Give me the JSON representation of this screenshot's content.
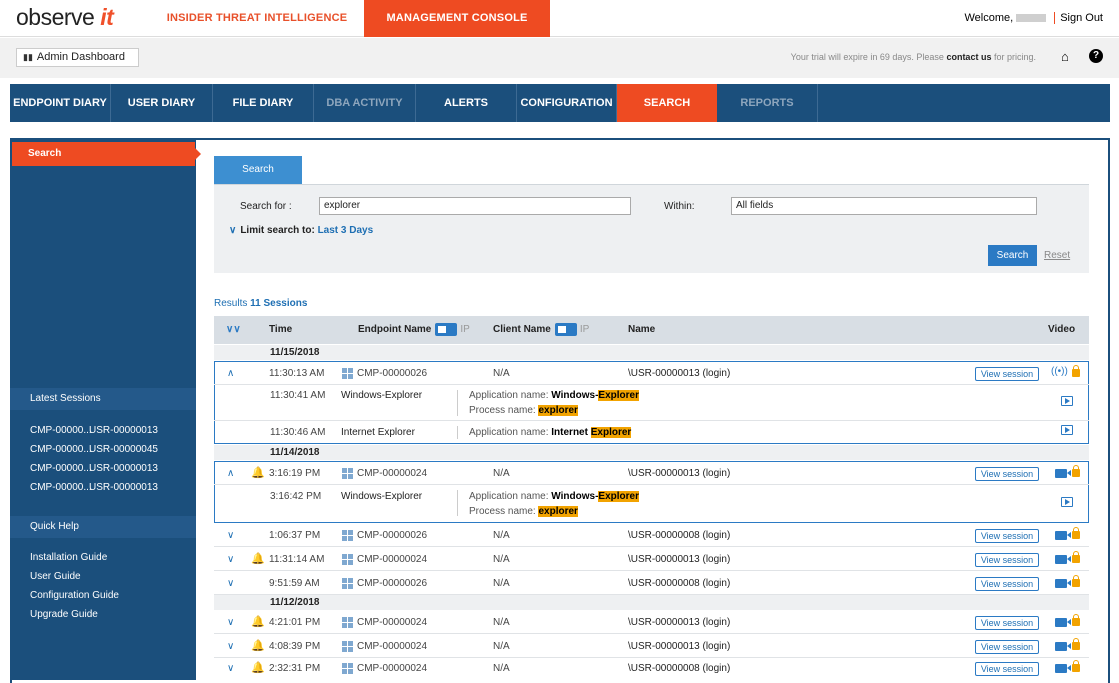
{
  "topbar": {
    "logo_text": "observe",
    "logo_accent": "it",
    "tab_insider": "INSIDER THREAT INTELLIGENCE",
    "tab_console": "MANAGEMENT CONSOLE",
    "welcome": "Welcome,",
    "sign_out": "Sign Out"
  },
  "subbar": {
    "admin_dashboard": "Admin Dashboard",
    "trial_text": "Your trial will expire in 69 days. Please",
    "contact": "contact us",
    "trial_suffix": "for pricing."
  },
  "nav": [
    "ENDPOINT DIARY",
    "USER DIARY",
    "FILE DIARY",
    "DBA ACTIVITY",
    "ALERTS",
    "CONFIGURATION",
    "SEARCH",
    "REPORTS"
  ],
  "sidebar": {
    "active": "Search",
    "latest_sessions_title": "Latest Sessions",
    "latest_sessions": [
      {
        "endpoint": "CMP-00000...",
        "user": "USR-00000013"
      },
      {
        "endpoint": "CMP-00000...",
        "user": "USR-00000045"
      },
      {
        "endpoint": "CMP-00000...",
        "user": "USR-00000013"
      },
      {
        "endpoint": "CMP-00000...",
        "user": "USR-00000013"
      }
    ],
    "quick_help_title": "Quick Help",
    "quick_help": [
      "Installation Guide",
      "User Guide",
      "Configuration Guide",
      "Upgrade Guide"
    ]
  },
  "search": {
    "tab": "Search",
    "search_for_label": "Search for :",
    "search_for_value": "explorer",
    "within_label": "Within:",
    "within_value": "All fields",
    "limit_label": "Limit search to:",
    "limit_value": "Last 3 Days",
    "search_button": "Search",
    "reset_button": "Reset"
  },
  "results": {
    "label": "Results",
    "count": "11 Sessions"
  },
  "table_headers": {
    "time": "Time",
    "endpoint": "Endpoint",
    "endpoint_name": "Name",
    "ip": "IP",
    "client": "Client",
    "client_name": "Name",
    "ip2": "IP",
    "name": "Name",
    "video": "Video"
  },
  "dates": [
    "11/15/2018",
    "11/14/2018",
    "11/12/2018"
  ],
  "view_session": "View session",
  "rows": [
    {
      "time": "11:30:13 AM",
      "endpoint": "CMP-00000026",
      "client": "N/A",
      "name": "\\USR-00000013 (login)"
    },
    {
      "time": "3:16:19 PM",
      "endpoint": "CMP-00000024",
      "client": "N/A",
      "name": "\\USR-00000013 (login)"
    },
    {
      "time": "1:06:37 PM",
      "endpoint": "CMP-00000026",
      "client": "N/A",
      "name": "\\USR-00000008 (login)"
    },
    {
      "time": "11:31:14 AM",
      "endpoint": "CMP-00000024",
      "client": "N/A",
      "name": "\\USR-00000013 (login)"
    },
    {
      "time": "9:51:59 AM",
      "endpoint": "CMP-00000026",
      "client": "N/A",
      "name": "\\USR-00000008 (login)"
    },
    {
      "time": "4:21:01 PM",
      "endpoint": "CMP-00000024",
      "client": "N/A",
      "name": "\\USR-00000013 (login)"
    },
    {
      "time": "4:08:39 PM",
      "endpoint": "CMP-00000024",
      "client": "N/A",
      "name": "\\USR-00000013 (login)"
    },
    {
      "time": "2:32:31 PM",
      "endpoint": "CMP-00000024",
      "client": "N/A",
      "name": "\\USR-00000008 (login)"
    }
  ],
  "subrows": [
    {
      "time": "11:30:41 AM",
      "app": "Windows-Explorer",
      "app_label": "Application name:",
      "app_pre": "Windows-",
      "app_hl": "Explorer",
      "proc_label": "Process name:",
      "proc_hl": "explorer"
    },
    {
      "time": "11:30:46 AM",
      "app": "Internet Explorer",
      "app_label": "Application name:",
      "app_pre": "Internet ",
      "app_hl": "Explorer"
    },
    {
      "time": "3:16:42 PM",
      "app": "Windows-Explorer",
      "app_label": "Application name:",
      "app_pre": "Windows-",
      "app_hl": "Explorer",
      "proc_label": "Process name:",
      "proc_hl": "explorer"
    }
  ]
}
